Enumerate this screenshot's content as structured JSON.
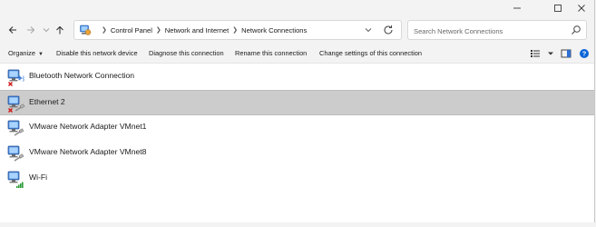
{
  "window": {
    "minimize_glyph": "–",
    "maximize_glyph": "□",
    "close_glyph": "✕"
  },
  "address": {
    "crumbs": [
      "Control Panel",
      "Network and Internet",
      "Network Connections"
    ]
  },
  "search": {
    "placeholder": "Search Network Connections"
  },
  "toolbar": {
    "organize": "Organize",
    "disable": "Disable this network device",
    "diagnose": "Diagnose this connection",
    "rename": "Rename this connection",
    "change": "Change settings of this connection"
  },
  "connections": [
    {
      "name": "Bluetooth Network Connection",
      "status": "disconnected",
      "badge": "bluetooth"
    },
    {
      "name": "Ethernet 2",
      "status": "disconnected",
      "badge": "cable",
      "selected": true
    },
    {
      "name": "VMware Network Adapter VMnet1",
      "status": "connected",
      "badge": "cable"
    },
    {
      "name": "VMware Network Adapter VMnet8",
      "status": "connected",
      "badge": "cable"
    },
    {
      "name": "Wi-Fi",
      "status": "connected",
      "badge": "wifi"
    }
  ],
  "colors": {
    "accent": "#0a64d8",
    "error": "#d01818",
    "selection": "#cccccc",
    "wifi": "#2e9b3a"
  }
}
